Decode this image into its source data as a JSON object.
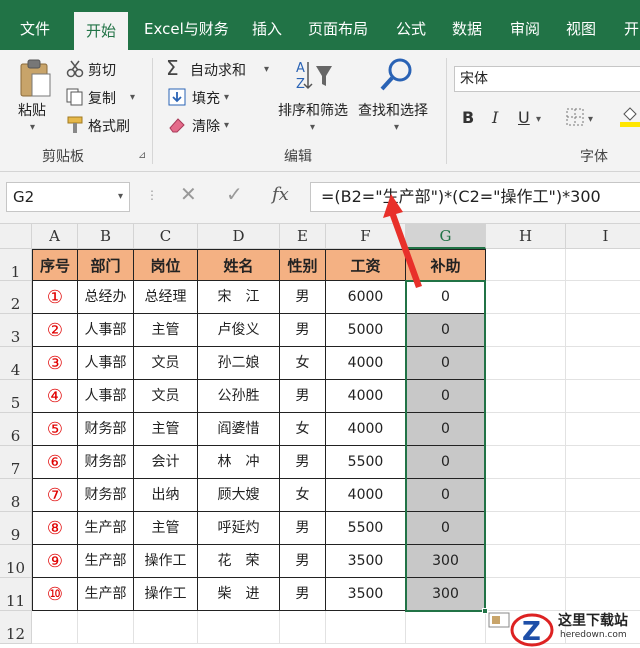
{
  "tabs": [
    "文件",
    "开始",
    "Excel与财务",
    "插入",
    "页面布局",
    "公式",
    "数据",
    "审阅",
    "视图",
    "开"
  ],
  "active_tab_index": 1,
  "clipboard": {
    "paste": "粘贴",
    "cut": "剪切",
    "copy": "复制",
    "format_painter": "格式刷",
    "group_label": "剪贴板"
  },
  "editing": {
    "autosum": "自动求和",
    "fill": "填充",
    "clear": "清除",
    "sort_filter": "排序和筛选",
    "find_select": "查找和选择",
    "group_label": "编辑"
  },
  "font": {
    "name": "宋体",
    "bold": "B",
    "italic": "I",
    "underline": "U",
    "group_label": "字体"
  },
  "formula_bar": {
    "name_box": "G2",
    "fx": "fx",
    "formula": "=(B2=\"生产部\")*(C2=\"操作工\")*300"
  },
  "sheet": {
    "columns": [
      "A",
      "B",
      "C",
      "D",
      "E",
      "F",
      "G",
      "H",
      "I"
    ],
    "selected_column": "G",
    "rows": [
      "1",
      "2",
      "3",
      "4",
      "5",
      "6",
      "7",
      "8",
      "9",
      "10",
      "11",
      "12"
    ],
    "header": [
      "序号",
      "部门",
      "岗位",
      "姓名",
      "性别",
      "工资",
      "补助"
    ],
    "data": [
      [
        "①",
        "总经办",
        "总经理",
        "宋　江",
        "男",
        "6000",
        "0"
      ],
      [
        "②",
        "人事部",
        "主管",
        "卢俊义",
        "男",
        "5000",
        "0"
      ],
      [
        "③",
        "人事部",
        "文员",
        "孙二娘",
        "女",
        "4000",
        "0"
      ],
      [
        "④",
        "人事部",
        "文员",
        "公孙胜",
        "男",
        "4000",
        "0"
      ],
      [
        "⑤",
        "财务部",
        "主管",
        "阎婆惜",
        "女",
        "4000",
        "0"
      ],
      [
        "⑥",
        "财务部",
        "会计",
        "林　冲",
        "男",
        "5500",
        "0"
      ],
      [
        "⑦",
        "财务部",
        "出纳",
        "顾大嫂",
        "女",
        "4000",
        "0"
      ],
      [
        "⑧",
        "生产部",
        "主管",
        "呼延灼",
        "男",
        "5500",
        "0"
      ],
      [
        "⑨",
        "生产部",
        "操作工",
        "花　荣",
        "男",
        "3500",
        "300"
      ],
      [
        "⑩",
        "生产部",
        "操作工",
        "柴　进",
        "男",
        "3500",
        "300"
      ]
    ]
  },
  "watermark": {
    "title": "这里下载站",
    "url": "heredown.com"
  },
  "colors": {
    "accent": "#217346",
    "header_fill": "#f4b183",
    "number_red": "#e00000",
    "arrow_red": "#e8302a"
  }
}
